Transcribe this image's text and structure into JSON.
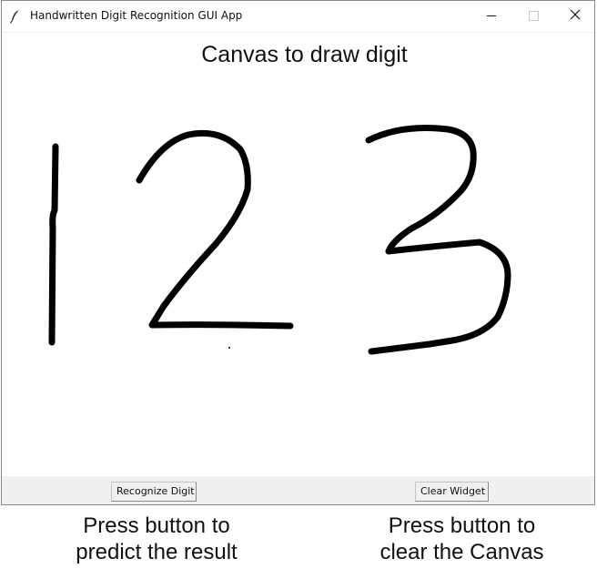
{
  "window": {
    "title": "Handwritten Digit Recognition GUI App",
    "icon": "feather-icon",
    "controls": [
      "minimize-icon",
      "maximize-icon",
      "close-icon"
    ]
  },
  "canvas": {
    "heading": "Canvas to draw digit",
    "drawn_digits": [
      "1",
      "2",
      "3"
    ],
    "stroke_color": "#000000",
    "background": "#ffffff"
  },
  "buttons": {
    "recognize_label": "Recognize Digit",
    "clear_label": "Clear Widget"
  },
  "annotations": {
    "left_line1": "Press button to",
    "left_line2": "predict the result",
    "right_line1": "Press button to",
    "right_line2": "clear the Canvas"
  },
  "colors": {
    "button_bar": "#f0f0f0",
    "window_border": "#8a8a8a"
  }
}
